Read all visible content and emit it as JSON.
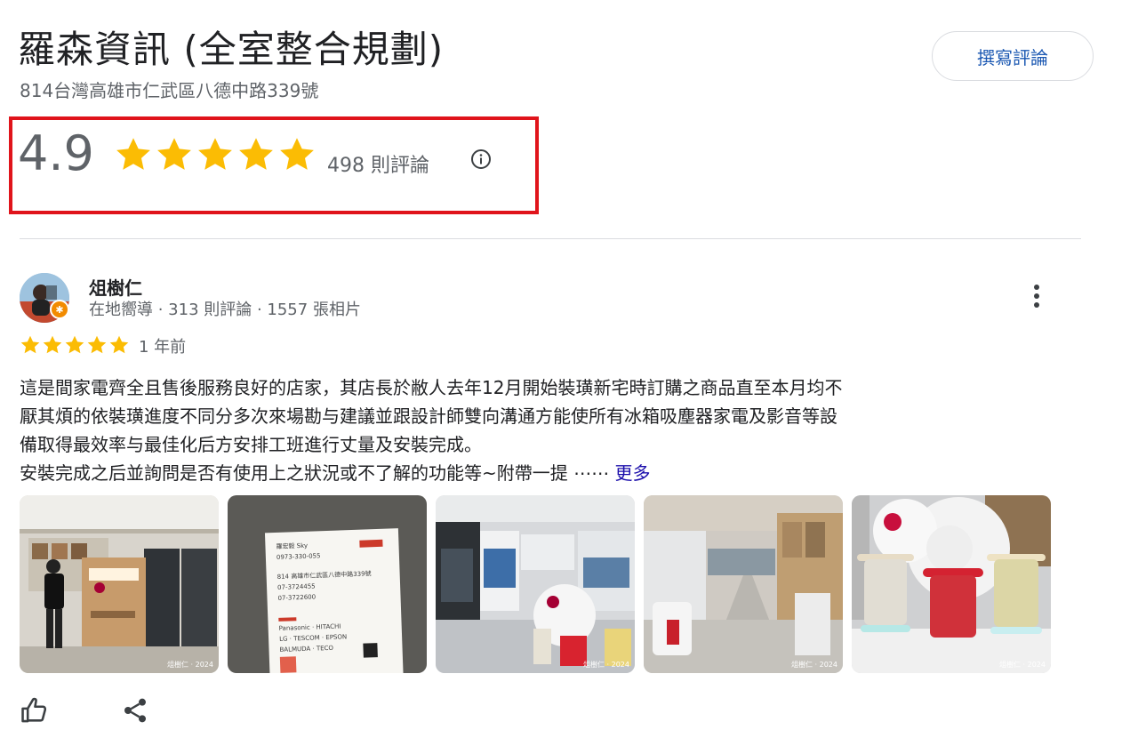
{
  "place": {
    "title": "羅森資訊 (全室整合規劃)",
    "address": "814台灣高雄市仁武區八德中路339號",
    "write_review_label": "撰寫評論"
  },
  "rating": {
    "value": "4.9",
    "stars": 5,
    "count_label": "498 則評論",
    "highlight_color": "#e0141b",
    "star_color": "#fbbc04"
  },
  "review": {
    "reviewer_name": "俎樹仁",
    "reviewer_meta": "在地嚮導 · 313 則評論 · 1557 張相片",
    "stars": 5,
    "time": "1 年前",
    "text_lines": [
      "這是間家電齊全且售後服務良好的店家，其店長於敝人去年12月開始裝璜新宅時訂購之商品直至本月均不",
      "厭其煩的依裝璜進度不同分多次來場勘与建議並跟設計師雙向溝通方能使所有冰箱吸塵器家電及影音等設",
      "備取得最效率与最佳化后方安排工班進行丈量及安裝完成。",
      "安裝完成之后並詢問是否有使用上之狀況或不了解的功能等~附帶一提 ⋯⋯ "
    ],
    "more_label": "更多",
    "photos": [
      {
        "name": "photo-store-refrigerator",
        "credit": "俎樹仁 · 2024"
      },
      {
        "name": "photo-business-card",
        "credit": ""
      },
      {
        "name": "photo-store-interior",
        "credit": "俎樹仁 · 2024"
      },
      {
        "name": "photo-store-aisle",
        "credit": "俎樹仁 · 2024"
      },
      {
        "name": "photo-lg-purifier-display",
        "credit": "俎樹仁 · 2024"
      }
    ],
    "business_card": {
      "lines": [
        "羅宏毅 Sky",
        "0973-330-055",
        "814 高雄市仁武區八德中路339號",
        "07-3724455",
        "07-3722600",
        "Panasonic · HITACHI",
        "LG · TESCOM · EPSON",
        "BALMUDA · TECO"
      ]
    },
    "actions": {
      "like_icon": "thumbs-up-icon",
      "share_icon": "share-icon"
    }
  }
}
